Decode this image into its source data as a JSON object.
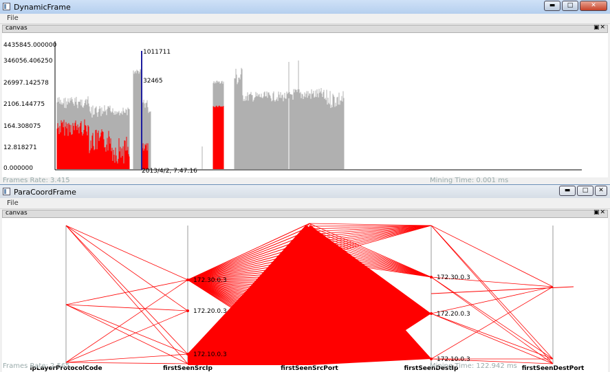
{
  "dynamic_frame": {
    "title": "DynamicFrame",
    "menu": "File",
    "canvas_label": "canvas",
    "window_controls": {
      "minimize": "▬",
      "maximize": "□",
      "close": "✕"
    },
    "y_ticks": [
      "4435845.000000",
      "346056.406250",
      "26997.142578",
      "2106.144775",
      "164.308075",
      "12.818271",
      "0.000000"
    ],
    "marker_top_label": "1011711",
    "marker_mid_label": "32465",
    "marker_time_label": "2013/4/2, 7:47:16",
    "frames_rate": "Frames Rate: 3.415",
    "mining_time": "Mining Time: 0.001 ms",
    "colors": {
      "gray": "#b0b0b0",
      "red": "#ff0000",
      "marker": "#1d1d9e"
    }
  },
  "paracoord_frame": {
    "title": "ParaCoordFrame",
    "menu": "File",
    "canvas_label": "canvas",
    "window_controls": {
      "minimize": "▬",
      "maximize": "□",
      "close": "✕"
    },
    "axes": [
      "ipLayerProtocolCode",
      "firstSeenSrcIp",
      "firstSeenSrcPort",
      "firstSeenDestIp",
      "firstSeenDestPort"
    ],
    "src_ip_labels": [
      "172.30.0.3",
      "172.20.0.3",
      "172.10.0.3"
    ],
    "dest_ip_labels": [
      "172.30.0.3",
      "172.20.0.3",
      "172.10.0.3"
    ],
    "frames_rate": "Frames Rate: 2.565",
    "mining_time": "Mining Time: 122.942 ms",
    "colors": {
      "lines": "#ff0000",
      "axis": "#999999"
    }
  }
}
